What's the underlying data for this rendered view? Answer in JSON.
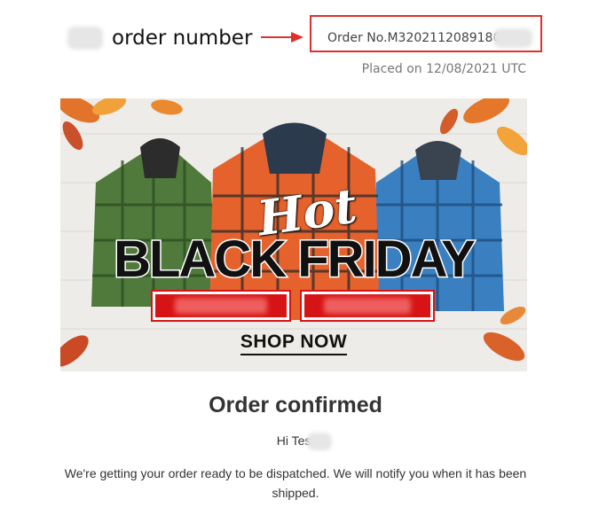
{
  "annotation": {
    "label": "order number"
  },
  "order": {
    "number_text": "Order No.M3202112089180",
    "placed_text": "Placed on 12/08/2021 UTC"
  },
  "banner": {
    "script_text": "Hot",
    "headline": "BLACK FRIDAY",
    "cta": "SHOP NOW"
  },
  "content": {
    "title": "Order confirmed",
    "greeting": "Hi Test",
    "message": "We're getting your order ready to be dispatched. We will notify you when it has been shipped."
  },
  "colors": {
    "highlight_red": "#e0302c",
    "tag_red": "#d61416"
  }
}
